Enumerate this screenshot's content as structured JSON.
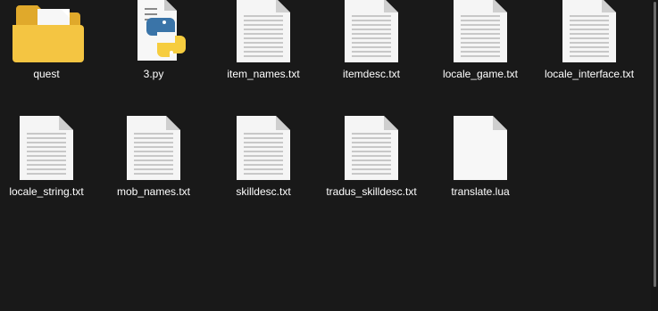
{
  "files": [
    {
      "name": "quest",
      "type": "folder"
    },
    {
      "name": "3.py",
      "type": "python-file"
    },
    {
      "name": "item_names.txt",
      "type": "text-file"
    },
    {
      "name": "itemdesc.txt",
      "type": "text-file"
    },
    {
      "name": "locale_game.txt",
      "type": "text-file"
    },
    {
      "name": "locale_interface.txt",
      "type": "text-file"
    },
    {
      "name": "locale_string.txt",
      "type": "text-file"
    },
    {
      "name": "mob_names.txt",
      "type": "text-file"
    },
    {
      "name": "skilldesc.txt",
      "type": "text-file"
    },
    {
      "name": "tradus_skilldesc.txt",
      "type": "text-file"
    },
    {
      "name": "translate.lua",
      "type": "blank-file"
    }
  ],
  "colors": {
    "background": "#191919",
    "folder": "#f4c542",
    "python_blue": "#3a74a8",
    "python_yellow": "#f6cd3f"
  }
}
